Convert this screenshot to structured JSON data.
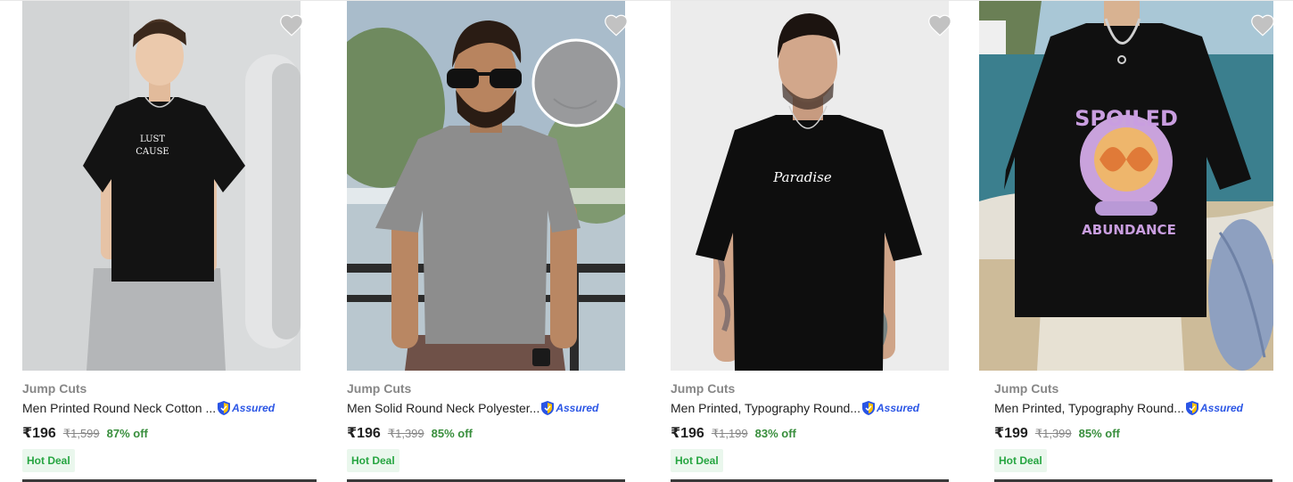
{
  "colors": {
    "price_green": "#388e3c",
    "assured_blue": "#2a55e5",
    "deal_green": "#26a541",
    "deal_bg": "#eaf7ed"
  },
  "products": [
    {
      "brand": "Jump Cuts",
      "title": "Men Printed Round Neck Cotton ...",
      "assured_label": "Assured",
      "price": "₹196",
      "mrp": "₹1,599",
      "discount": "87% off",
      "deal": "Hot Deal",
      "shirt_print": [
        "LUST",
        "CAUSE"
      ],
      "shirt_color": "#131313",
      "wishlist_icon": "heart-icon"
    },
    {
      "brand": "Jump Cuts",
      "title": "Men Solid Round Neck Polyester...",
      "assured_label": "Assured",
      "price": "₹196",
      "mrp": "₹1,399",
      "discount": "85% off",
      "deal": "Hot Deal",
      "shirt_print": [],
      "shirt_color": "#8d8d8d",
      "wishlist_icon": "heart-icon"
    },
    {
      "brand": "Jump Cuts",
      "title": "Men Printed, Typography Round...",
      "assured_label": "Assured",
      "price": "₹196",
      "mrp": "₹1,199",
      "discount": "83% off",
      "deal": "Hot Deal",
      "shirt_print": [
        "Paradise"
      ],
      "shirt_color": "#0e0e0e",
      "wishlist_icon": "heart-icon"
    },
    {
      "brand": "Jump Cuts",
      "title": "Men Printed, Typography Round...",
      "assured_label": "Assured",
      "price": "₹199",
      "mrp": "₹1,399",
      "discount": "85% off",
      "deal": "Hot Deal",
      "shirt_print": [
        "SPOILED",
        "ABUNDANCE"
      ],
      "shirt_color": "#101010",
      "wishlist_icon": "heart-icon"
    }
  ]
}
